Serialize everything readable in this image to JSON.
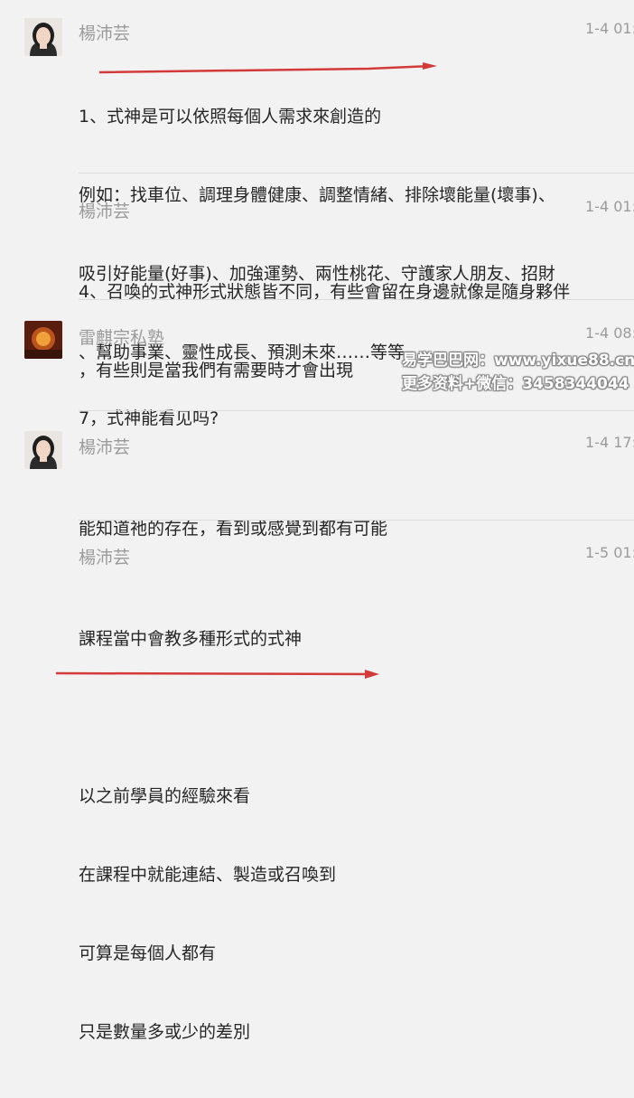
{
  "colors": {
    "underline": "#d43a3a",
    "name": "#9b9b9b",
    "text": "#262626",
    "background": "#f2f2f2"
  },
  "messages": [
    {
      "sender": "楊沛芸",
      "time": "1-4 01:",
      "lines": [
        "1、式神是可以依照每個人需求來創造的",
        "例如：找車位、調理身體健康、調整情緒、排除壞能量(壞事)、",
        "吸引好能量(好事)、加強運勢、兩性桃花、守護家人朋友、招財",
        "、幫助事業、靈性成長、預測未來……等等"
      ]
    },
    {
      "sender": "楊沛芸",
      "time": "1-4 01:",
      "lines": [
        "4、召喚的式神形式狀態皆不同，有些會留在身邊就像是隨身夥伴",
        "，有些則是當我們有需要時才會出現"
      ]
    },
    {
      "sender": "雷麒宗私塾",
      "time": "1-4 08:",
      "lines": [
        "7，式神能看见吗?"
      ]
    },
    {
      "sender": "楊沛芸",
      "time": "1-4 17:",
      "lines": [
        "能知道祂的存在，看到或感覺到都有可能"
      ]
    },
    {
      "sender": "楊沛芸",
      "time": "1-5 01:",
      "lines": [
        "課程當中會教多種形式的式神",
        "",
        "以之前學員的經驗來看",
        "在課程中就能連結、製造或召喚到",
        "可算是每個人都有",
        "只是數量多或少的差別"
      ]
    }
  ],
  "watermark": {
    "line1": "易学巴巴网：www.yixue88.cn",
    "line2": "更多资料+微信：3458344044"
  }
}
